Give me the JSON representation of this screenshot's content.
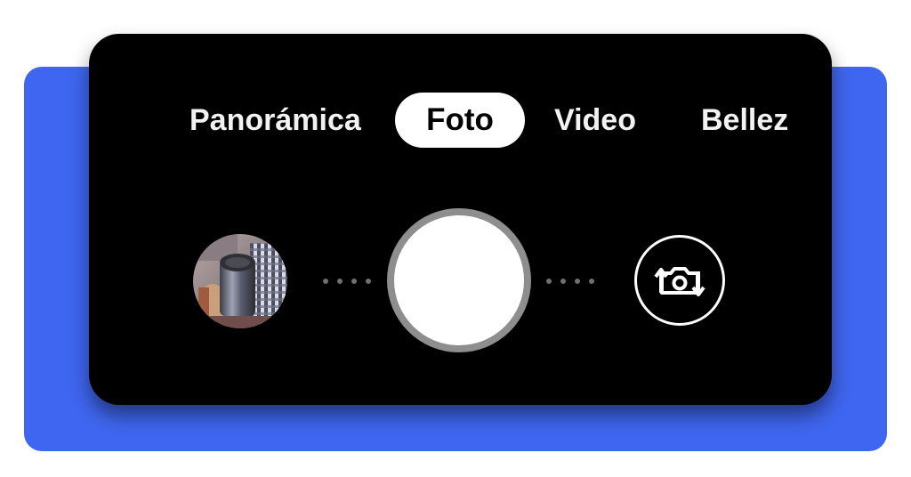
{
  "mode_selector": {
    "modes": [
      {
        "label": "Panorámica",
        "active": false
      },
      {
        "label": "Foto",
        "active": true
      },
      {
        "label": "Video",
        "active": false
      },
      {
        "label": "Bellez",
        "active": false
      }
    ]
  },
  "controls": {
    "gallery_thumbnail": "gallery-thumbnail",
    "shutter": "shutter-button",
    "switch_camera_icon": "switch-camera-icon"
  },
  "colors": {
    "accent_background": "#3f66f0",
    "panel_background": "#000000",
    "active_tab_background": "#ffffff",
    "inactive_tab_text": "#f2f2f2",
    "shutter_ring": "#8e8e8e"
  }
}
